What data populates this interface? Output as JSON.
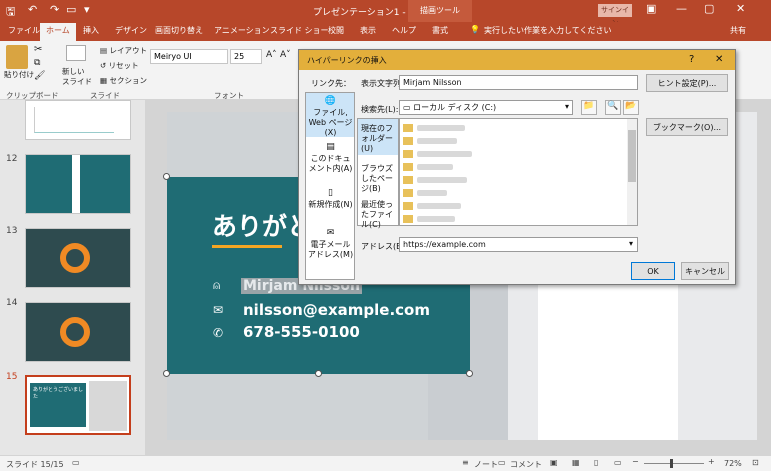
{
  "titlebar": {
    "title": "プレゼンテーション1 - PowerPoint",
    "context_tab": "描画ツール",
    "signin": "サインイン"
  },
  "tabs": [
    "ファイル",
    "ホーム",
    "挿入",
    "デザイン",
    "画面切り替え",
    "アニメーション",
    "スライド ショー",
    "校閲",
    "表示",
    "ヘルプ",
    "書式"
  ],
  "tell_me": "実行したい作業を入力してください",
  "share": "共有",
  "ribbon": {
    "paste": "貼り付け",
    "clipboard": "クリップボード",
    "new_slide": "新しい\nスライド",
    "layout": "レイアウト",
    "reset": "リセット",
    "section": "セクション",
    "slides": "スライド",
    "font_name": "Meiryo UI",
    "font_size": "25",
    "font_group": "フォント"
  },
  "thumbnails": [
    {
      "num": "12"
    },
    {
      "num": "13"
    },
    {
      "num": "14"
    },
    {
      "num": "15",
      "text": "ありがとうございました"
    }
  ],
  "slide": {
    "heading": "ありがと",
    "name": "Mirjam Nilsson",
    "email": "nilsson@example.com",
    "phone": "678-555-0100"
  },
  "status": {
    "slide": "スライド 15/15",
    "notes": "ノート",
    "comments": "コメント",
    "zoom": "72%"
  },
  "dialog": {
    "title": "ハイパーリンクの挿入",
    "help": "?",
    "close": "✕",
    "link_to": "リンク先：",
    "nav": [
      "ファイル, Web ページ(X)",
      "このドキュメント内(A)",
      "新規作成(N)",
      "電子メール アドレス(M)"
    ],
    "display_text_label": "表示文字列(T):",
    "display_text": "Mirjam Nilsson",
    "screentip": "ヒント設定(P)...",
    "lookin_label": "検索先(L):",
    "lookin_value": "ローカル ディスク (C:)",
    "side": [
      "現在のフォルダー(U)",
      "ブラウズしたページ(B)",
      "最近使ったファイル(C)"
    ],
    "bookmark": "ブックマーク(O)...",
    "address_label": "アドレス(E):",
    "address": "https://example.com",
    "ok": "OK",
    "cancel": "キャンセル"
  },
  "colors": {
    "accent": "#b7472a",
    "teal": "#1f6c74",
    "dialog_title": "#e3af3b"
  }
}
